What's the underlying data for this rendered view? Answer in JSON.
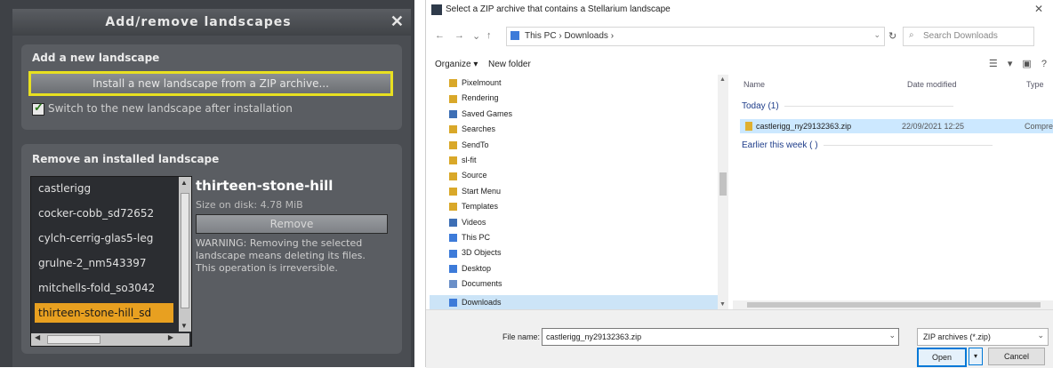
{
  "stellarium": {
    "title": "Add/remove landscapes",
    "close_glyph": "✕",
    "add_group": {
      "title": "Add a new landscape",
      "install_button": "Install a new landscape from a ZIP archive...",
      "switch_checkbox_label": "Switch to the new landscape after installation",
      "switch_checked": true
    },
    "remove_group": {
      "title": "Remove an installed landscape",
      "landscapes": [
        "castlerigg",
        "cocker-cobb_sd72652",
        "cylch-cerrig-glas5-leg",
        "grulne-2_nm543397",
        "mitchells-fold_so3042",
        "thirteen-stone-hill_sd"
      ],
      "selected_index": 5,
      "selected_name": "thirteen-stone-hill",
      "size_text": "Size on disk: 4.78 MiB",
      "remove_button": "Remove",
      "warning_text": "WARNING: Removing the selected landscape means deleting its files. This operation is irreversible."
    }
  },
  "file_dialog": {
    "title": "Select a ZIP archive that contains a Stellarium landscape",
    "close_glyph": "✕",
    "nav": {
      "back": "←",
      "forward": "→",
      "dropdown": "⌄",
      "up": "↑"
    },
    "address": {
      "path": "This PC  ›  Downloads  ›",
      "dropdown": "⌄"
    },
    "refresh": "↻",
    "search_placeholder": "Search Downloads",
    "toolbar": {
      "organize": "Organize ▾",
      "new_folder": "New folder"
    },
    "view_icons": [
      "☰",
      "▾",
      "▣",
      "?"
    ],
    "nav_items": [
      {
        "label": "Pixelmount",
        "color": "#d9a829"
      },
      {
        "label": "Rendering",
        "color": "#d9a829"
      },
      {
        "label": "Saved Games",
        "color": "#3d6fb5"
      },
      {
        "label": "Searches",
        "color": "#d9a829"
      },
      {
        "label": "SendTo",
        "color": "#d9a829"
      },
      {
        "label": "sl-fit",
        "color": "#d9a829"
      },
      {
        "label": "Source",
        "color": "#d9a829"
      },
      {
        "label": "Start Menu",
        "color": "#d9a829"
      },
      {
        "label": "Templates",
        "color": "#d9a829"
      },
      {
        "label": "Videos",
        "color": "#3d6fb5"
      },
      {
        "label": "This PC",
        "color": "#3d7bd9"
      },
      {
        "label": "3D Objects",
        "color": "#3d7bd9"
      },
      {
        "label": "Desktop",
        "color": "#3d7bd9"
      },
      {
        "label": "Documents",
        "color": "#6a8fc8"
      },
      {
        "label": "Downloads",
        "color": "#3d7bd9"
      }
    ],
    "selected_nav_index": 14,
    "columns": {
      "name": "Name",
      "date": "Date modified",
      "type": "Type"
    },
    "groups": [
      {
        "label": "Today (1)"
      },
      {
        "label": "Earlier this week ( )"
      }
    ],
    "file": {
      "name": "castlerigg_ny29132363.zip",
      "date": "22/09/2021 12:25",
      "type": "Compres"
    },
    "filename_label": "File name:",
    "filename_value": "castlerigg_ny29132363.zip",
    "filetype": "ZIP archives (*.zip)",
    "open_button": "Open",
    "open_dropdown": "▾",
    "cancel_button": "Cancel"
  }
}
